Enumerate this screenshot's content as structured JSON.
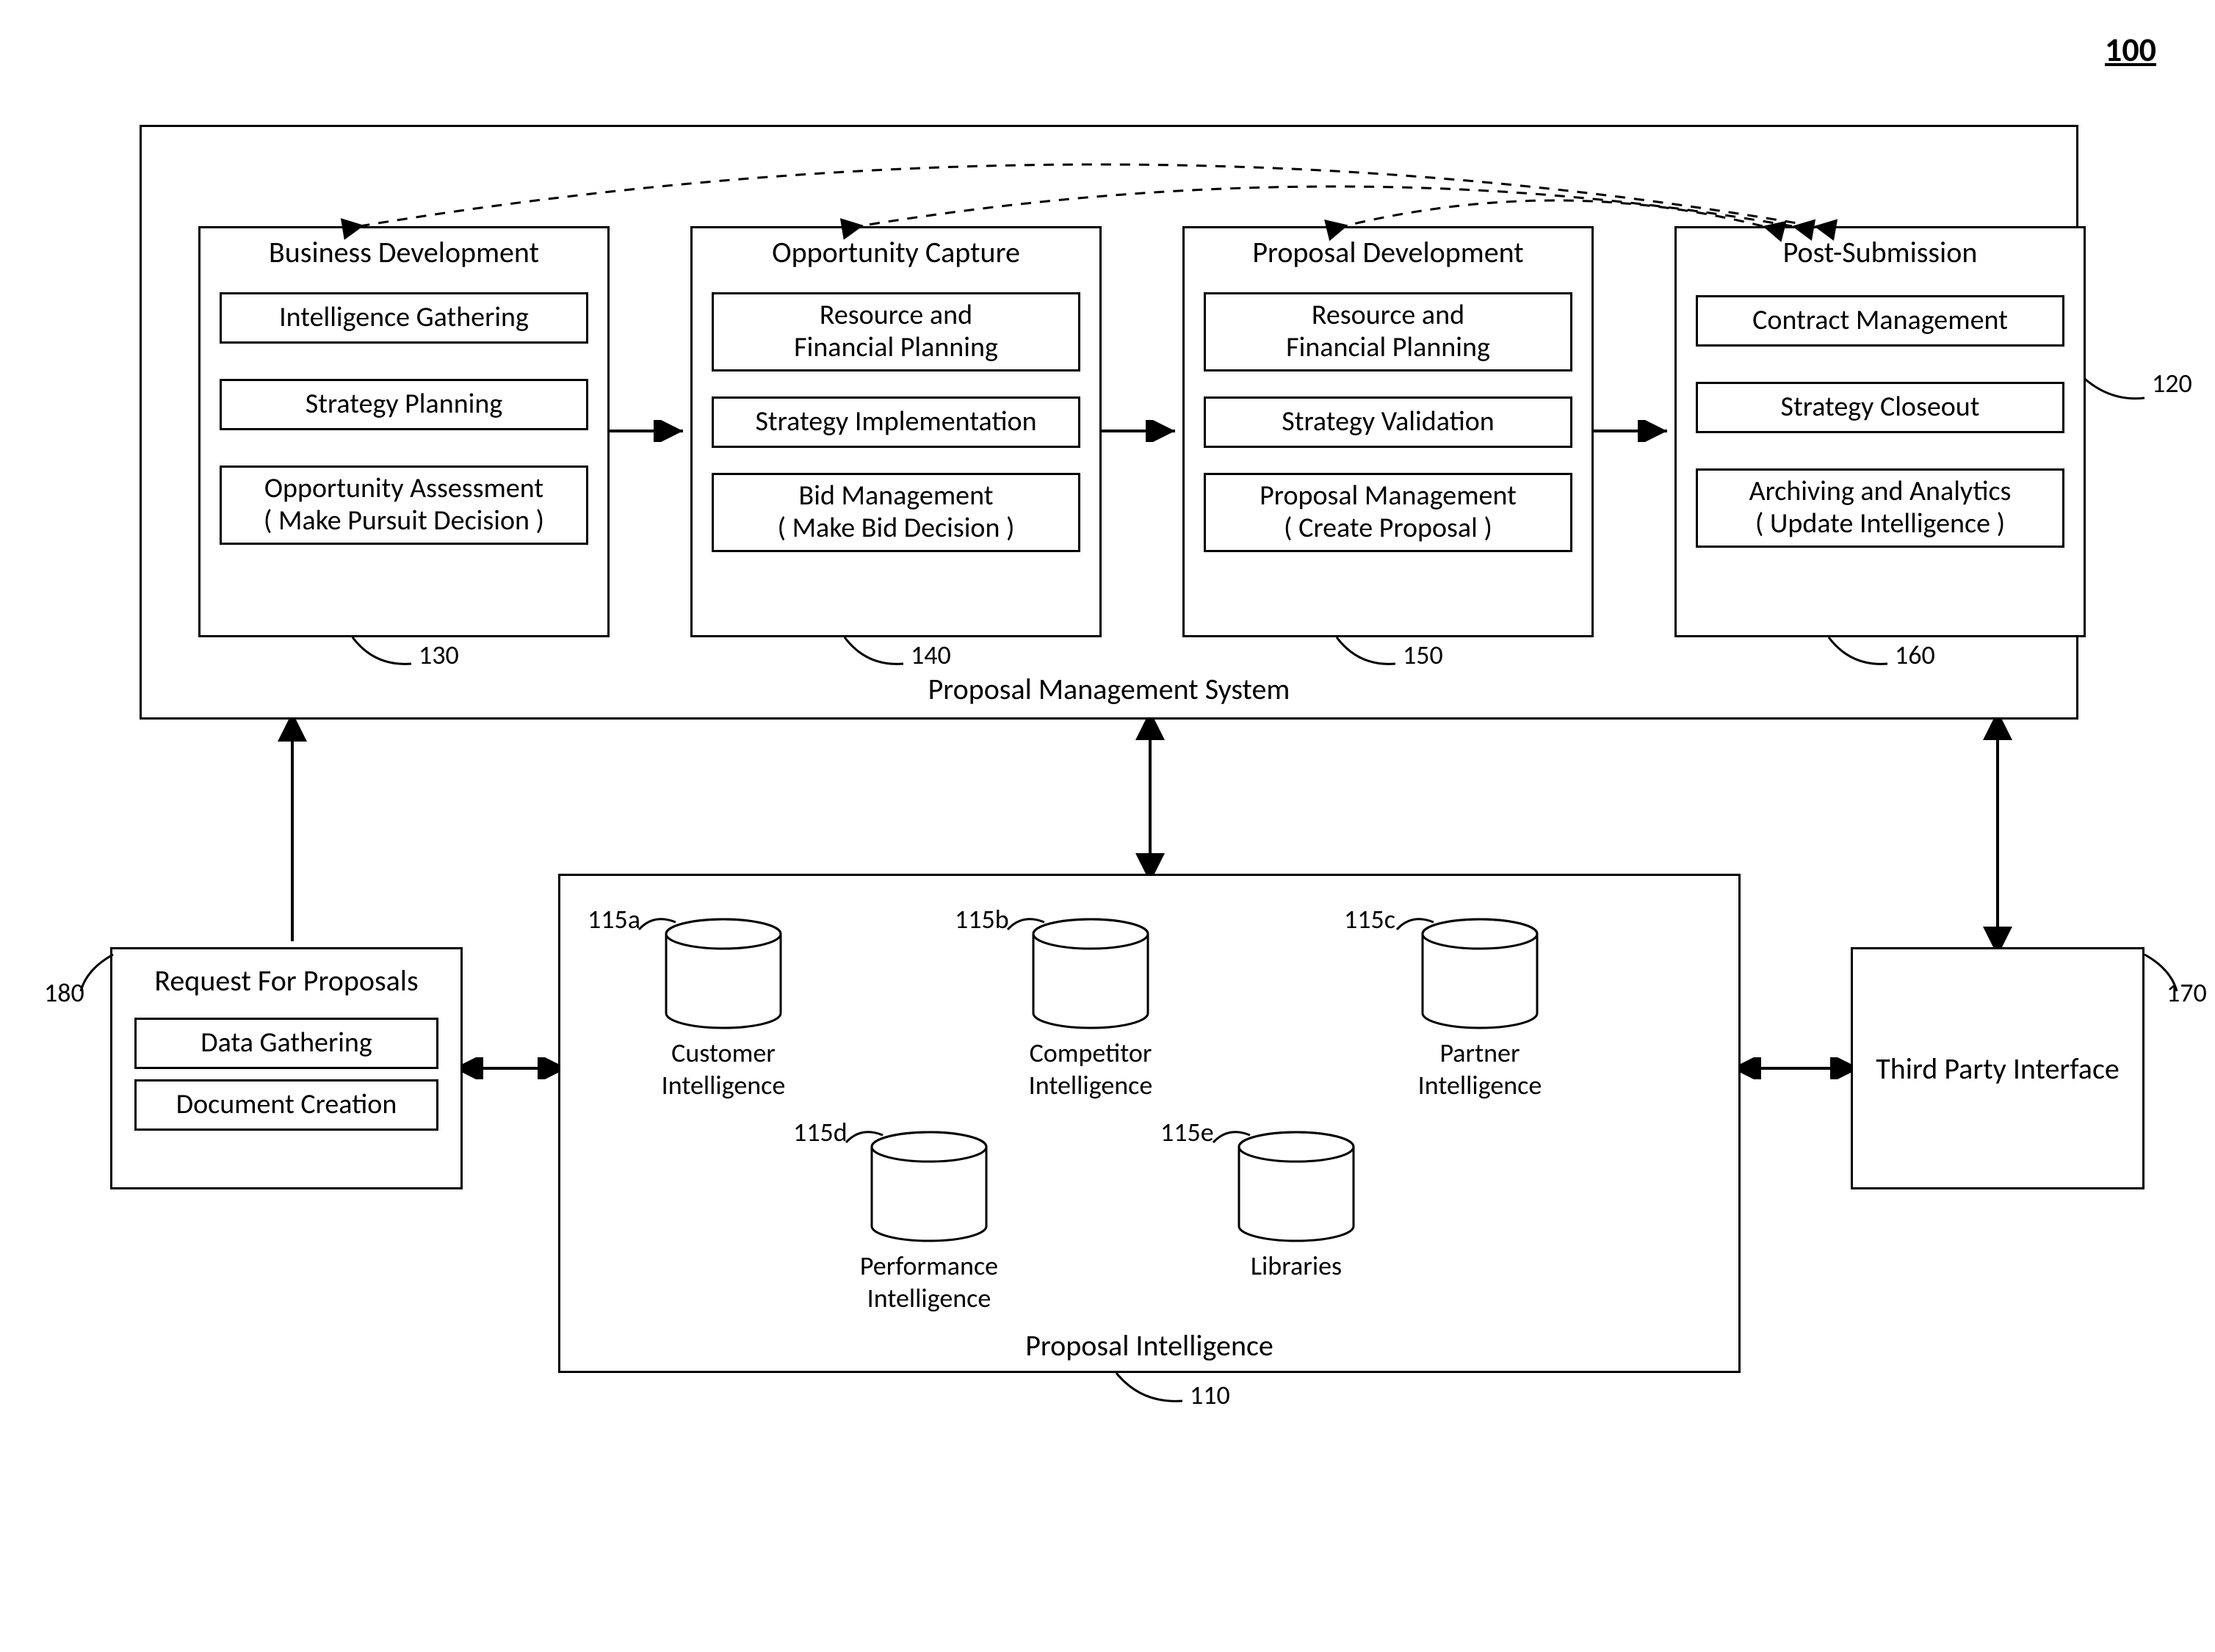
{
  "figure_ref": "100",
  "pms": {
    "title": "Proposal Management System",
    "ref_outer": "120",
    "cols": [
      {
        "title": "Business Development",
        "ref": "130",
        "cells": [
          "Intelligence Gathering",
          "Strategy Planning",
          "Opportunity Assessment\n( Make Pursuit Decision )"
        ]
      },
      {
        "title": "Opportunity Capture",
        "ref": "140",
        "cells": [
          "Resource and\nFinancial Planning",
          "Strategy Implementation",
          "Bid Management\n( Make Bid Decision )"
        ]
      },
      {
        "title": "Proposal Development",
        "ref": "150",
        "cells": [
          "Resource and\nFinancial Planning",
          "Strategy Validation",
          "Proposal Management\n( Create Proposal )"
        ]
      },
      {
        "title": "Post-Submission",
        "ref": "160",
        "cells": [
          "Contract Management",
          "Strategy Closeout",
          "Archiving and Analytics\n( Update Intelligence )"
        ]
      }
    ]
  },
  "rfp": {
    "title": "Request For Proposals",
    "ref": "180",
    "cells": [
      "Data Gathering",
      "Document Creation"
    ]
  },
  "pi": {
    "title": "Proposal Intelligence",
    "ref": "110",
    "dbs": [
      {
        "id": "a",
        "ref": "115a",
        "label": "Customer\nIntelligence"
      },
      {
        "id": "b",
        "ref": "115b",
        "label": "Competitor\nIntelligence"
      },
      {
        "id": "c",
        "ref": "115c",
        "label": "Partner\nIntelligence"
      },
      {
        "id": "d",
        "ref": "115d",
        "label": "Performance\nIntelligence"
      },
      {
        "id": "e",
        "ref": "115e",
        "label": "Libraries"
      }
    ]
  },
  "tpi": {
    "title": "Third Party Interface",
    "ref": "170"
  }
}
